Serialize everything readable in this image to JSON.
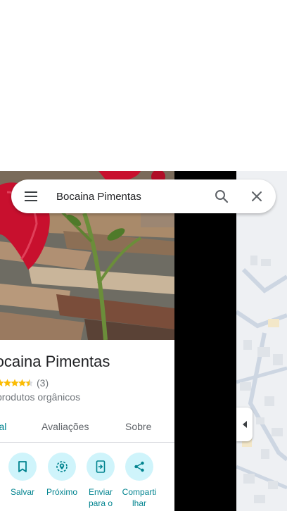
{
  "search": {
    "query": "Bocaina Pimentas"
  },
  "place": {
    "name": "Bocaina Pimentas",
    "rating_count": "(3)",
    "rating_stars": 4.5,
    "category": "produtos orgânicos"
  },
  "tabs": [
    {
      "label": "Visão geral",
      "visible": "eral",
      "active": true
    },
    {
      "label": "Avaliações",
      "visible": "Avaliações",
      "active": false
    },
    {
      "label": "Sobre",
      "visible": "Sobre",
      "active": false
    }
  ],
  "actions": [
    {
      "label": "Salvar",
      "icon": "bookmark-icon"
    },
    {
      "label": "Próximo",
      "icon": "nearby-icon"
    },
    {
      "label": "Enviar\npara o",
      "icon": "send-to-phone-icon"
    },
    {
      "label": "Comparti\nlhar",
      "icon": "share-icon"
    }
  ],
  "colors": {
    "accent": "#00838f",
    "action_bg": "#cff4fb",
    "star": "#fbbc04",
    "map_bg": "#eef0f3"
  }
}
